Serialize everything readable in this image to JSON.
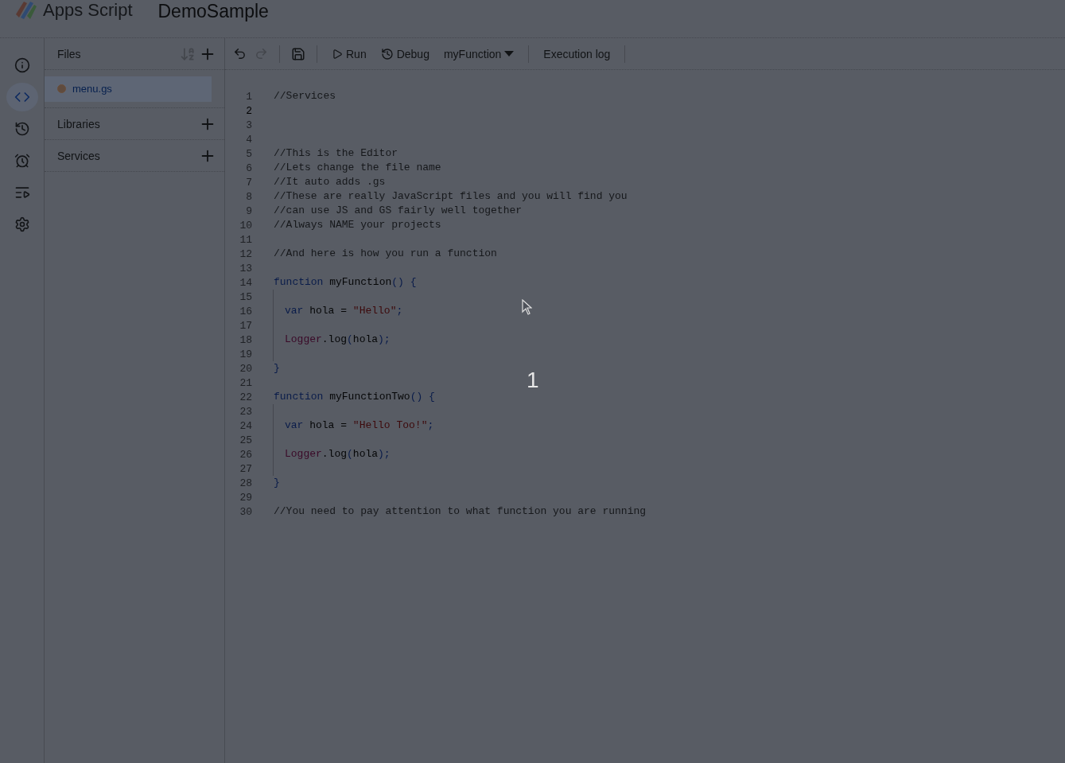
{
  "header": {
    "product": "Apps Script",
    "project": "DemoSample"
  },
  "rail": [
    {
      "kind": "info",
      "selected": false
    },
    {
      "kind": "code",
      "selected": true
    },
    {
      "kind": "history",
      "selected": false
    },
    {
      "kind": "triggers",
      "selected": false
    },
    {
      "kind": "executions",
      "selected": false
    },
    {
      "kind": "settings",
      "selected": false
    }
  ],
  "files_panel": {
    "title": "Files",
    "files": [
      {
        "name": "menu.gs",
        "selected": true
      }
    ],
    "sections": [
      {
        "title": "Libraries"
      },
      {
        "title": "Services"
      }
    ]
  },
  "toolbar": {
    "undo": {
      "disabled": false
    },
    "redo": {
      "disabled": true
    },
    "run": "Run",
    "debug": "Debug",
    "function_select": "myFunction",
    "execution_log": "Execution log"
  },
  "editor": {
    "lines": [
      {
        "number": "1",
        "current": false,
        "indented": false,
        "tokens": [
          {
            "kind": "comment",
            "text": "//Services"
          }
        ]
      },
      {
        "number": "2",
        "current": true,
        "indented": false
      },
      {
        "number": "3",
        "current": false,
        "indented": false
      },
      {
        "number": "4",
        "current": false,
        "indented": false
      },
      {
        "number": "5",
        "current": false,
        "indented": false,
        "tokens": [
          {
            "kind": "comment",
            "text": "//This is the Editor"
          }
        ]
      },
      {
        "number": "6",
        "current": false,
        "indented": false,
        "tokens": [
          {
            "kind": "comment",
            "text": "//Lets change the file name"
          }
        ]
      },
      {
        "number": "7",
        "current": false,
        "indented": false,
        "tokens": [
          {
            "kind": "comment",
            "text": "//It auto adds .gs"
          }
        ]
      },
      {
        "number": "8",
        "current": false,
        "indented": false,
        "tokens": [
          {
            "kind": "comment",
            "text": "//These are really JavaScript files and you will find you"
          }
        ]
      },
      {
        "number": "9",
        "current": false,
        "indented": false,
        "tokens": [
          {
            "kind": "comment",
            "text": "//can use JS and GS fairly well together"
          }
        ]
      },
      {
        "number": "10",
        "current": false,
        "indented": false,
        "tokens": [
          {
            "kind": "comment",
            "text": "//Always NAME your projects"
          }
        ]
      },
      {
        "number": "11",
        "current": false,
        "indented": false
      },
      {
        "number": "12",
        "current": false,
        "indented": false,
        "tokens": [
          {
            "kind": "comment",
            "text": "//And here is how you run a function"
          }
        ]
      },
      {
        "number": "13",
        "current": false,
        "indented": false
      },
      {
        "number": "14",
        "current": false,
        "indented": false,
        "tokens": [
          {
            "kind": "keyword",
            "text": "function "
          },
          {
            "kind": "plain",
            "text": "myFunction"
          },
          {
            "kind": "punct",
            "text": "() {"
          }
        ]
      },
      {
        "number": "15",
        "current": false,
        "indented": true
      },
      {
        "number": "16",
        "current": false,
        "indented": true,
        "tokens": [
          {
            "kind": "keyword",
            "text": "var "
          },
          {
            "kind": "plain",
            "text": "hola = "
          },
          {
            "kind": "string",
            "text": "\"Hello\""
          },
          {
            "kind": "punct",
            "text": ";"
          }
        ]
      },
      {
        "number": "17",
        "current": false,
        "indented": true
      },
      {
        "number": "18",
        "current": false,
        "indented": true,
        "tokens": [
          {
            "kind": "object",
            "text": "Logger"
          },
          {
            "kind": "plain",
            "text": ".log"
          },
          {
            "kind": "punct",
            "text": "("
          },
          {
            "kind": "plain",
            "text": "hola"
          },
          {
            "kind": "punct",
            "text": ");"
          }
        ]
      },
      {
        "number": "19",
        "current": false,
        "indented": true
      },
      {
        "number": "20",
        "current": false,
        "indented": false,
        "tokens": [
          {
            "kind": "punct",
            "text": "}"
          }
        ]
      },
      {
        "number": "21",
        "current": false,
        "indented": false
      },
      {
        "number": "22",
        "current": false,
        "indented": false,
        "tokens": [
          {
            "kind": "keyword",
            "text": "function "
          },
          {
            "kind": "plain",
            "text": "myFunctionTwo"
          },
          {
            "kind": "punct",
            "text": "() {"
          }
        ]
      },
      {
        "number": "23",
        "current": false,
        "indented": true
      },
      {
        "number": "24",
        "current": false,
        "indented": true,
        "tokens": [
          {
            "kind": "keyword",
            "text": "var "
          },
          {
            "kind": "plain",
            "text": "hola = "
          },
          {
            "kind": "string",
            "text": "\"Hello Too!\""
          },
          {
            "kind": "punct",
            "text": ";"
          }
        ]
      },
      {
        "number": "25",
        "current": false,
        "indented": true
      },
      {
        "number": "26",
        "current": false,
        "indented": true,
        "tokens": [
          {
            "kind": "object",
            "text": "Logger"
          },
          {
            "kind": "plain",
            "text": ".log"
          },
          {
            "kind": "punct",
            "text": "("
          },
          {
            "kind": "plain",
            "text": "hola"
          },
          {
            "kind": "punct",
            "text": ");"
          }
        ]
      },
      {
        "number": "27",
        "current": false,
        "indented": true
      },
      {
        "number": "28",
        "current": false,
        "indented": false,
        "tokens": [
          {
            "kind": "punct",
            "text": "}"
          }
        ]
      },
      {
        "number": "29",
        "current": false,
        "indented": false
      },
      {
        "number": "30",
        "current": false,
        "indented": false,
        "tokens": [
          {
            "kind": "comment",
            "text": "//You need to pay attention to what function you are running"
          }
        ]
      }
    ]
  },
  "countdown": "1"
}
